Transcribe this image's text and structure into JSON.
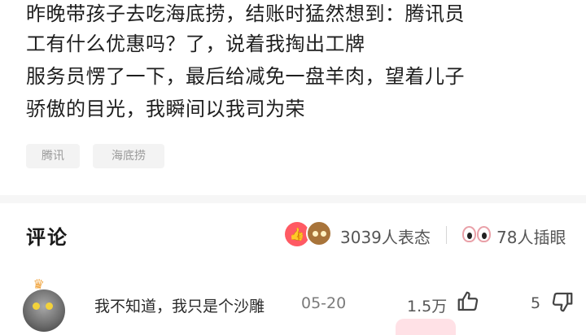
{
  "post": {
    "lines": [
      "昨晚带孩子去吃海底捞，结账时猛然想到：腾讯员",
      "工有什么优惠吗？了，说着我掏出工牌",
      "服务员愣了一下，最后给减免一盘羊肉，望着儿子",
      "骄傲的目光，我瞬间以我司为荣"
    ]
  },
  "tags": [
    "腾讯",
    "海底捞"
  ],
  "comments_section": {
    "title": "评论",
    "reactions_count": "3039人表态",
    "eyes_count": "78人插眼"
  },
  "comment": {
    "text": "我不知道，我只是个沙雕",
    "date": "05-20",
    "likes": "1.5万",
    "dislikes": "5"
  },
  "icons": {
    "like": "thumbs-up-icon",
    "dislike": "thumbs-down-icon",
    "reaction_like": "like-reaction-icon",
    "reaction_brown": "emoji-reaction-icon",
    "eyes": "eyes-icon",
    "crown": "crown-icon"
  },
  "colors": {
    "accent_red": "#ff5a63",
    "tag_bg": "#f3f3f3",
    "muted_text": "#9a9a9a"
  }
}
